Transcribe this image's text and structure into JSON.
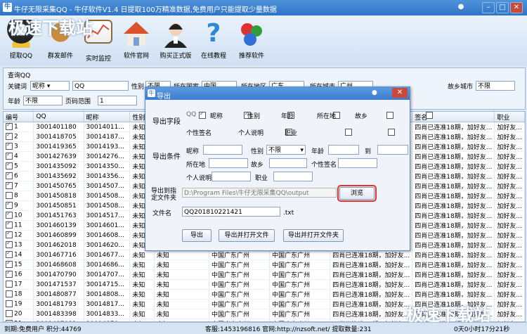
{
  "window": {
    "title": "牛仔无限采集QQ - 牛仔软件V1.4 日提取100万精准数据,免费用户只能提取少量数据",
    "min": "–",
    "max": "□",
    "close": "✕"
  },
  "toolbar": [
    {
      "label": "提取QQ",
      "icon": "penguin-icon",
      "color": "#1f1f1f"
    },
    {
      "label": "群发邮件",
      "icon": "dog-icon",
      "color": "#c98a3c"
    },
    {
      "label": "实时监控",
      "icon": "chart-board-icon",
      "color": "#d94b3a"
    },
    {
      "label": "软件官网",
      "icon": "house-icon",
      "color": "#d9532c"
    },
    {
      "label": "购买正式版",
      "icon": "headset-agent-icon",
      "color": "#222"
    },
    {
      "label": "在线教程",
      "icon": "question-icon",
      "color": "#2f88d6"
    },
    {
      "label": "推荐软件",
      "icon": "molecule-icon",
      "color": "#e03030"
    }
  ],
  "query": {
    "legend": "查询QQ",
    "keyword_label": "关键词",
    "keyword_type": "昵称",
    "keyword_value": "QQ",
    "gender_label": "性别",
    "gender_value": "不限",
    "country_label": "所在国家",
    "country_value": "中国",
    "province_label": "所在地区",
    "province_value": "广东",
    "city_label": "所在城市",
    "city_value": "广州",
    "hometown_label": "故乡城市",
    "hometown_value": "不限",
    "age_label": "年龄",
    "age_value": "不限",
    "page_label": "页码范围",
    "page_value": "1"
  },
  "grid": {
    "headers": [
      "编号",
      "QQ",
      "昵称",
      "性别",
      "年龄",
      "",
      "",
      "所在地",
      "",
      "",
      " 签名",
      "",
      "职业"
    ],
    "cols": [
      "编号",
      "QQ",
      "昵称",
      "性别"
    ],
    "extra_headers": {
      "sig": "签名",
      "job": "职业"
    },
    "rows": [
      {
        "n": "1",
        "qq": "3001401180",
        "nick": "30014011...",
        "sex": "未知",
        "on": true
      },
      {
        "n": "2",
        "qq": "3001418705",
        "nick": "30014187...",
        "sex": "未知",
        "on": true
      },
      {
        "n": "3",
        "qq": "3001419365",
        "nick": "30014193...",
        "sex": "未知",
        "on": true
      },
      {
        "n": "4",
        "qq": "3001427639",
        "nick": "30014276...",
        "sex": "未知",
        "on": true
      },
      {
        "n": "5",
        "qq": "3001435092",
        "nick": "30014350...",
        "sex": "未知",
        "on": true
      },
      {
        "n": "6",
        "qq": "3001435692",
        "nick": "30014356...",
        "sex": "未知",
        "on": true
      },
      {
        "n": "7",
        "qq": "3001450765",
        "nick": "30014507...",
        "sex": "未知",
        "on": true
      },
      {
        "n": "8",
        "qq": "3001450818",
        "nick": "30014508...",
        "sex": "未知",
        "on": false
      },
      {
        "n": "9",
        "qq": "3001450851",
        "nick": "30014508...",
        "sex": "未知",
        "on": true
      },
      {
        "n": "10",
        "qq": "3001451763",
        "nick": "30014517...",
        "sex": "未知",
        "on": true
      },
      {
        "n": "11",
        "qq": "3001460139",
        "nick": "30014601...",
        "sex": "未知",
        "on": true
      },
      {
        "n": "12",
        "qq": "3001460899",
        "nick": "30014608...",
        "sex": "未知",
        "on": true
      },
      {
        "n": "13",
        "qq": "3001462018",
        "nick": "30014620...",
        "sex": "未知",
        "on": true
      },
      {
        "n": "14",
        "qq": "3001467716",
        "nick": "30014677...",
        "sex": "未知",
        "on": true
      },
      {
        "n": "15",
        "qq": "3001468608",
        "nick": "30014686...",
        "sex": "未知",
        "on": true
      },
      {
        "n": "16",
        "qq": "3001470790",
        "nick": "30014707...",
        "sex": "未知",
        "on": true
      },
      {
        "n": "17",
        "qq": "3001471537",
        "nick": "30014715...",
        "sex": "未知",
        "on": false
      },
      {
        "n": "18",
        "qq": "3001480877",
        "nick": "30014808...",
        "sex": "未知",
        "on": false
      },
      {
        "n": "19",
        "qq": "3001481793",
        "nick": "30014817...",
        "sex": "未知",
        "on": false
      },
      {
        "n": "20",
        "qq": "3001483398",
        "nick": "30014833...",
        "sex": "未知",
        "on": false
      },
      {
        "n": "21",
        "qq": "3001487082",
        "nick": "30014870...",
        "sex": "未知",
        "on": false
      }
    ],
    "right_col": "加好友...",
    "lower_rows": {
      "loc": "中国广东广州",
      "sig": "四肖已连准18期，加好友..."
    }
  },
  "status": {
    "left": "到期:免费用户 积分:44769",
    "mid": "客服:1453196816 官网:http://nzsoft.net/ 提取数量:231",
    "right": "0天0小时17分21秒"
  },
  "watermark": "极速下载站",
  "dialog": {
    "title": "导出",
    "fields_label": "导出字段",
    "f_qq": "QQ",
    "f_nick": "昵称",
    "f_sex": "性别",
    "f_age": "年龄",
    "f_loc": "所在地",
    "f_home": "故乡",
    "f_sig": "个性签名",
    "f_desc": "个人说明",
    "f_job": "职业",
    "cond_label": "导出条件",
    "c_nick": "昵称",
    "c_sex": "性别",
    "c_sex_value": "不限",
    "c_age": "年龄",
    "c_to": "到",
    "c_loc": "所在地",
    "c_home": "故乡",
    "c_sig": "个性签名",
    "c_desc": "个人说明",
    "c_job": "职业",
    "dir_label": "导出到指定文件夹",
    "dir_value": "D:\\Program Files\\牛仔无限采集QQ\\output",
    "browse": "浏览",
    "name_label": "文件名",
    "name_value": "QQ201810221421",
    "ext": ".txt",
    "btn_export": "导出",
    "btn_open_file": "导出并打开文件",
    "btn_open_folder": "导出并打开文件夹"
  }
}
